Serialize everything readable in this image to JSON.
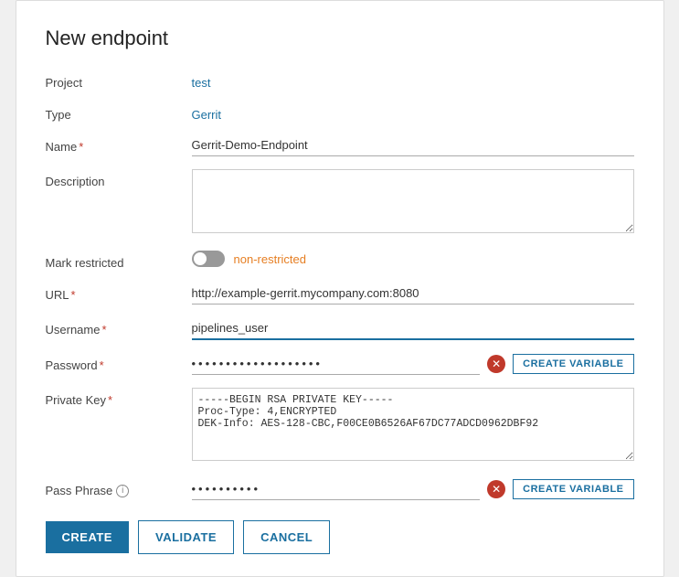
{
  "dialog": {
    "title": "New endpoint"
  },
  "form": {
    "project_label": "Project",
    "project_value": "test",
    "type_label": "Type",
    "type_value": "Gerrit",
    "name_label": "Name",
    "name_required": "*",
    "name_value": "Gerrit-Demo-Endpoint",
    "description_label": "Description",
    "description_value": "",
    "mark_restricted_label": "Mark restricted",
    "toggle_status": "non-restricted",
    "url_label": "URL",
    "url_required": "*",
    "url_value": "http://example-gerrit.mycompany.com:8080",
    "username_label": "Username",
    "username_required": "*",
    "username_value": "pipelines_user",
    "password_label": "Password",
    "password_required": "*",
    "password_value": "••••••••••••••••••••••••••••",
    "create_variable_label": "CREATE VARIABLE",
    "private_key_label": "Private Key",
    "private_key_required": "*",
    "private_key_value": "-----BEGIN RSA PRIVATE KEY-----\nProc-Type: 4,ENCRYPTED\nDEK-Info: AES-128-CBC,F00CE0B6526AF67DC77ADCD0962DBF92",
    "pass_phrase_label": "Pass Phrase",
    "pass_phrase_value": "•••••••",
    "create_variable_label2": "CREATE VARIABLE"
  },
  "footer": {
    "create_label": "CREATE",
    "validate_label": "VALIDATE",
    "cancel_label": "CANCEL"
  },
  "icons": {
    "clear": "✕",
    "info": "i",
    "scroll_up": "▲",
    "scroll_down": "▼"
  }
}
